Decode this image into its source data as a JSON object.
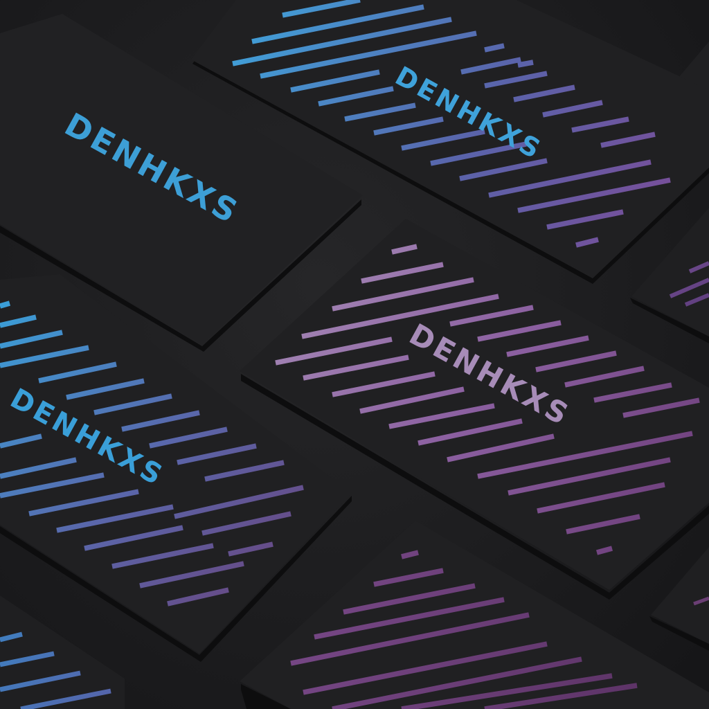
{
  "brand": {
    "wordmark": "DENHKXS"
  },
  "colors": {
    "background": "#1c1c1e",
    "card": "#1f1f21",
    "card_edge": "#0e0e0f",
    "blue": "#3d9fd6",
    "indigo": "#5d6aae",
    "violet": "#7e5a9e",
    "lilac": "#a48ab5",
    "plum": "#6e3f78"
  },
  "cards": [
    {
      "id": "card-blue-wordmark",
      "side": "front",
      "pattern": "none",
      "gradient": "blue"
    },
    {
      "id": "card-top-stripes",
      "side": "back",
      "pattern": "diagonal-stripes",
      "gradient": "blue-to-violet"
    },
    {
      "id": "card-center-stripes",
      "side": "back",
      "pattern": "diagonal-stripes",
      "gradient": "lilac-to-plum"
    },
    {
      "id": "card-left-stripes",
      "side": "back",
      "pattern": "diagonal-stripes",
      "gradient": "blue-to-plum"
    },
    {
      "id": "card-bottom-stripes",
      "side": "back",
      "pattern": "diagonal-stripes",
      "gradient": "plum"
    }
  ]
}
